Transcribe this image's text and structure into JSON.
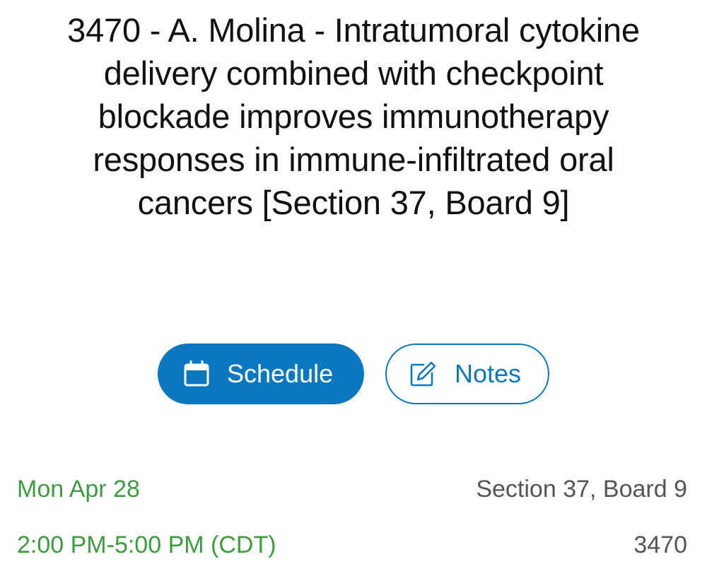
{
  "session": {
    "title": "3470 - A. Molina - Intratumoral cytokine delivery combined with checkpoint blockade improves immunotherapy responses in immune-infiltrated oral cancers [Section 37, Board 9]"
  },
  "actions": {
    "schedule_label": "Schedule",
    "notes_label": "Notes",
    "schedule_icon": "calendar-icon",
    "notes_icon": "edit-note-icon"
  },
  "details": {
    "date": "Mon Apr 28",
    "time": "2:00 PM-5:00 PM (CDT)",
    "location": "Section 37, Board 9",
    "abstract_number": "3470"
  },
  "colors": {
    "accent": "#0c78c2",
    "date_green": "#3d9c3f",
    "secondary_text": "#555555"
  }
}
